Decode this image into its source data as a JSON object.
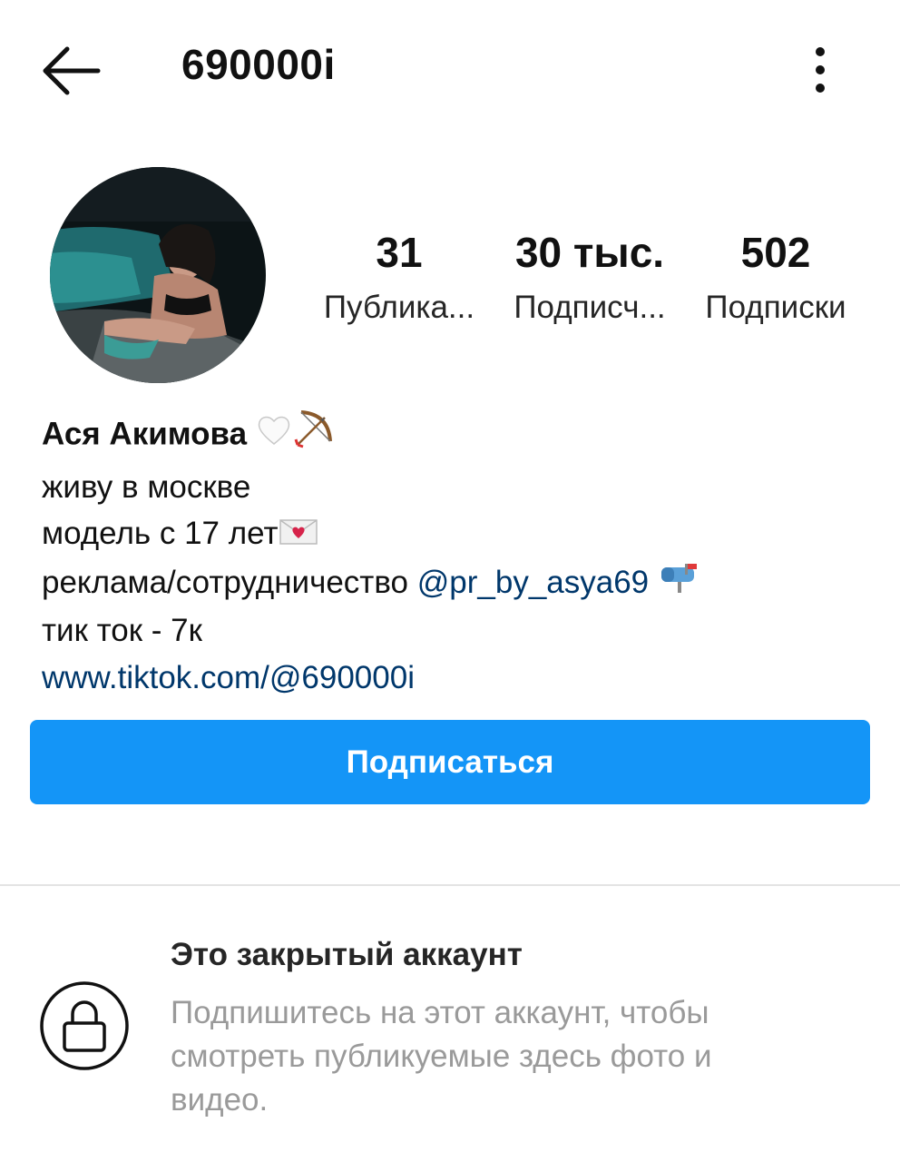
{
  "header": {
    "back_icon": "arrow-left-icon",
    "username": "690000i",
    "more_icon": "more-vertical-icon"
  },
  "profile": {
    "avatar_icon": "profile-photo",
    "stats": [
      {
        "value": "31",
        "label": "Публика..."
      },
      {
        "value": "30 тыс.",
        "label": "Подписч..."
      },
      {
        "value": "502",
        "label": "Подписки"
      }
    ],
    "bio": {
      "full_name": "Ася Акимова",
      "line1": "живу в москве",
      "line2": "модель с 17 лет",
      "line3_prefix": "реклама/сотрудничество ",
      "mention": "@pr_by_asya69",
      "line4": "тик ток - 7к",
      "link": "www.tiktok.com/@690000i"
    },
    "emojis": [
      "white-heart-icon",
      "bow-and-arrow-icon",
      "love-letter-icon",
      "mailbox-icon"
    ]
  },
  "actions": {
    "follow_label": "Подписаться",
    "accent_color": "#1495f7"
  },
  "private_account": {
    "lock_icon": "lock-icon",
    "title": "Это закрытый аккаунт",
    "description": "Подпишитесь на этот аккаунт, чтобы смотреть публикуемые здесь фото и видео."
  }
}
